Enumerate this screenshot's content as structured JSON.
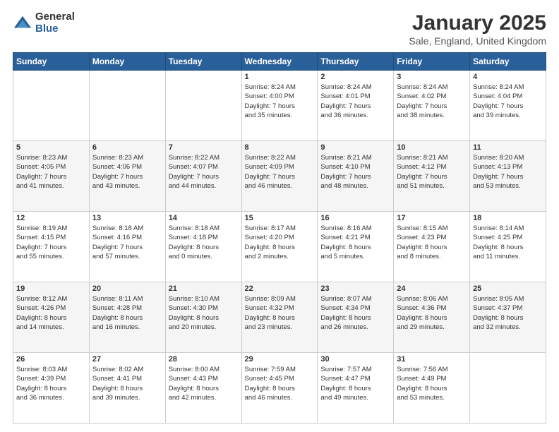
{
  "logo": {
    "general": "General",
    "blue": "Blue"
  },
  "title": "January 2025",
  "location": "Sale, England, United Kingdom",
  "days_of_week": [
    "Sunday",
    "Monday",
    "Tuesday",
    "Wednesday",
    "Thursday",
    "Friday",
    "Saturday"
  ],
  "weeks": [
    [
      {
        "day": "",
        "info": ""
      },
      {
        "day": "",
        "info": ""
      },
      {
        "day": "",
        "info": ""
      },
      {
        "day": "1",
        "info": "Sunrise: 8:24 AM\nSunset: 4:00 PM\nDaylight: 7 hours\nand 35 minutes."
      },
      {
        "day": "2",
        "info": "Sunrise: 8:24 AM\nSunset: 4:01 PM\nDaylight: 7 hours\nand 36 minutes."
      },
      {
        "day": "3",
        "info": "Sunrise: 8:24 AM\nSunset: 4:02 PM\nDaylight: 7 hours\nand 38 minutes."
      },
      {
        "day": "4",
        "info": "Sunrise: 8:24 AM\nSunset: 4:04 PM\nDaylight: 7 hours\nand 39 minutes."
      }
    ],
    [
      {
        "day": "5",
        "info": "Sunrise: 8:23 AM\nSunset: 4:05 PM\nDaylight: 7 hours\nand 41 minutes."
      },
      {
        "day": "6",
        "info": "Sunrise: 8:23 AM\nSunset: 4:06 PM\nDaylight: 7 hours\nand 43 minutes."
      },
      {
        "day": "7",
        "info": "Sunrise: 8:22 AM\nSunset: 4:07 PM\nDaylight: 7 hours\nand 44 minutes."
      },
      {
        "day": "8",
        "info": "Sunrise: 8:22 AM\nSunset: 4:09 PM\nDaylight: 7 hours\nand 46 minutes."
      },
      {
        "day": "9",
        "info": "Sunrise: 8:21 AM\nSunset: 4:10 PM\nDaylight: 7 hours\nand 48 minutes."
      },
      {
        "day": "10",
        "info": "Sunrise: 8:21 AM\nSunset: 4:12 PM\nDaylight: 7 hours\nand 51 minutes."
      },
      {
        "day": "11",
        "info": "Sunrise: 8:20 AM\nSunset: 4:13 PM\nDaylight: 7 hours\nand 53 minutes."
      }
    ],
    [
      {
        "day": "12",
        "info": "Sunrise: 8:19 AM\nSunset: 4:15 PM\nDaylight: 7 hours\nand 55 minutes."
      },
      {
        "day": "13",
        "info": "Sunrise: 8:18 AM\nSunset: 4:16 PM\nDaylight: 7 hours\nand 57 minutes."
      },
      {
        "day": "14",
        "info": "Sunrise: 8:18 AM\nSunset: 4:18 PM\nDaylight: 8 hours\nand 0 minutes."
      },
      {
        "day": "15",
        "info": "Sunrise: 8:17 AM\nSunset: 4:20 PM\nDaylight: 8 hours\nand 2 minutes."
      },
      {
        "day": "16",
        "info": "Sunrise: 8:16 AM\nSunset: 4:21 PM\nDaylight: 8 hours\nand 5 minutes."
      },
      {
        "day": "17",
        "info": "Sunrise: 8:15 AM\nSunset: 4:23 PM\nDaylight: 8 hours\nand 8 minutes."
      },
      {
        "day": "18",
        "info": "Sunrise: 8:14 AM\nSunset: 4:25 PM\nDaylight: 8 hours\nand 11 minutes."
      }
    ],
    [
      {
        "day": "19",
        "info": "Sunrise: 8:12 AM\nSunset: 4:26 PM\nDaylight: 8 hours\nand 14 minutes."
      },
      {
        "day": "20",
        "info": "Sunrise: 8:11 AM\nSunset: 4:28 PM\nDaylight: 8 hours\nand 16 minutes."
      },
      {
        "day": "21",
        "info": "Sunrise: 8:10 AM\nSunset: 4:30 PM\nDaylight: 8 hours\nand 20 minutes."
      },
      {
        "day": "22",
        "info": "Sunrise: 8:09 AM\nSunset: 4:32 PM\nDaylight: 8 hours\nand 23 minutes."
      },
      {
        "day": "23",
        "info": "Sunrise: 8:07 AM\nSunset: 4:34 PM\nDaylight: 8 hours\nand 26 minutes."
      },
      {
        "day": "24",
        "info": "Sunrise: 8:06 AM\nSunset: 4:36 PM\nDaylight: 8 hours\nand 29 minutes."
      },
      {
        "day": "25",
        "info": "Sunrise: 8:05 AM\nSunset: 4:37 PM\nDaylight: 8 hours\nand 32 minutes."
      }
    ],
    [
      {
        "day": "26",
        "info": "Sunrise: 8:03 AM\nSunset: 4:39 PM\nDaylight: 8 hours\nand 36 minutes."
      },
      {
        "day": "27",
        "info": "Sunrise: 8:02 AM\nSunset: 4:41 PM\nDaylight: 8 hours\nand 39 minutes."
      },
      {
        "day": "28",
        "info": "Sunrise: 8:00 AM\nSunset: 4:43 PM\nDaylight: 8 hours\nand 42 minutes."
      },
      {
        "day": "29",
        "info": "Sunrise: 7:59 AM\nSunset: 4:45 PM\nDaylight: 8 hours\nand 46 minutes."
      },
      {
        "day": "30",
        "info": "Sunrise: 7:57 AM\nSunset: 4:47 PM\nDaylight: 8 hours\nand 49 minutes."
      },
      {
        "day": "31",
        "info": "Sunrise: 7:56 AM\nSunset: 4:49 PM\nDaylight: 8 hours\nand 53 minutes."
      },
      {
        "day": "",
        "info": ""
      }
    ]
  ]
}
